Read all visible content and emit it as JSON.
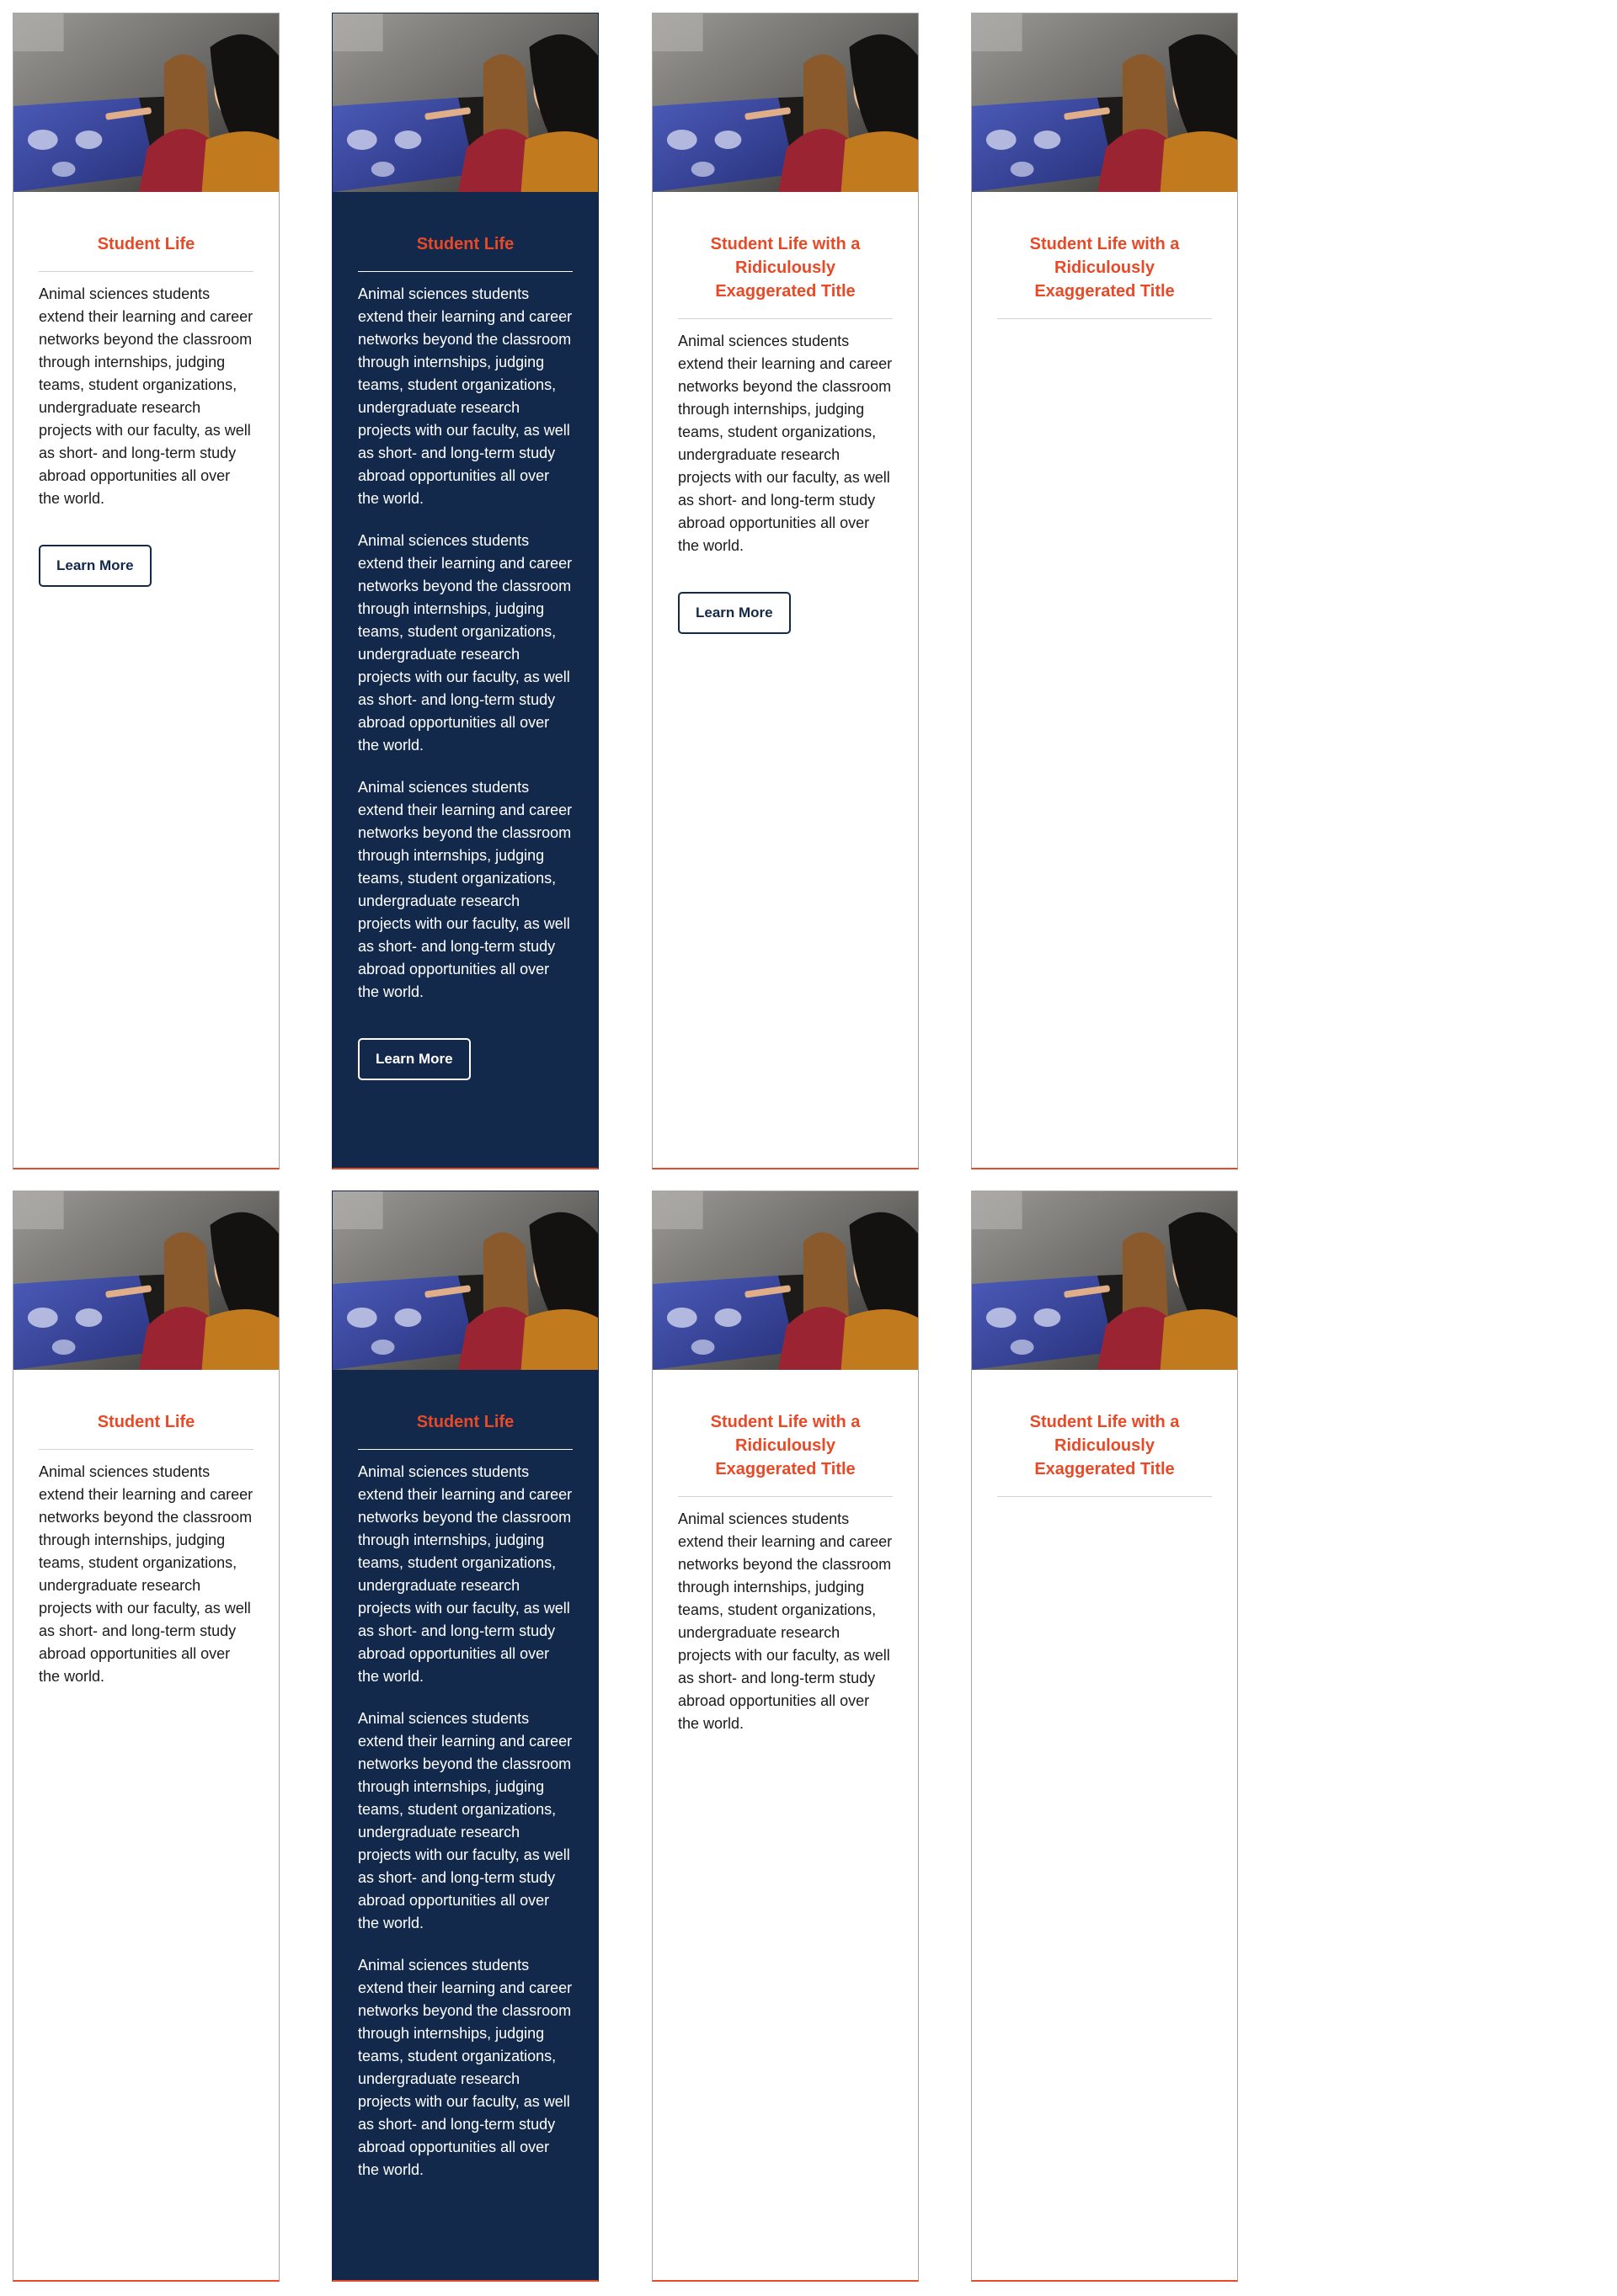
{
  "paragraph": "Animal sciences students extend their learning and career networks beyond the classroom through internships, judging teams, student organizations, undergraduate research projects with our faculty, as well as short- and long-term study abroad opportunities all over the world.",
  "cards": [
    {
      "title": "Student Life",
      "button": "Learn More",
      "image_alt": "Two students looking at a touchscreen display"
    },
    {
      "title": "Student Life",
      "button": "Learn More",
      "image_alt": "Two students looking at a touchscreen display"
    },
    {
      "title": "Student Life with a Ridiculously Exaggerated Title",
      "button": "Learn More",
      "image_alt": "Two students looking at a touchscreen display"
    },
    {
      "title": "Student Life with a Ridiculously Exaggerated Title",
      "image_alt": "Two students looking at a touchscreen display"
    },
    {
      "title": "Student Life",
      "image_alt": "Two students looking at a touchscreen display"
    },
    {
      "title": "Student Life",
      "image_alt": "Two students looking at a touchscreen display"
    },
    {
      "title": "Student Life with a Ridiculously Exaggerated Title",
      "image_alt": "Two students looking at a touchscreen display"
    },
    {
      "title": "Student Life with a Ridiculously Exaggerated Title",
      "image_alt": "Two students looking at a touchscreen display"
    }
  ],
  "colors": {
    "accent": "#e84a27",
    "navy": "#13294b",
    "border": "#a7a7a7"
  },
  "icons": {
    "photo": "students-at-touchscreen-photo"
  }
}
